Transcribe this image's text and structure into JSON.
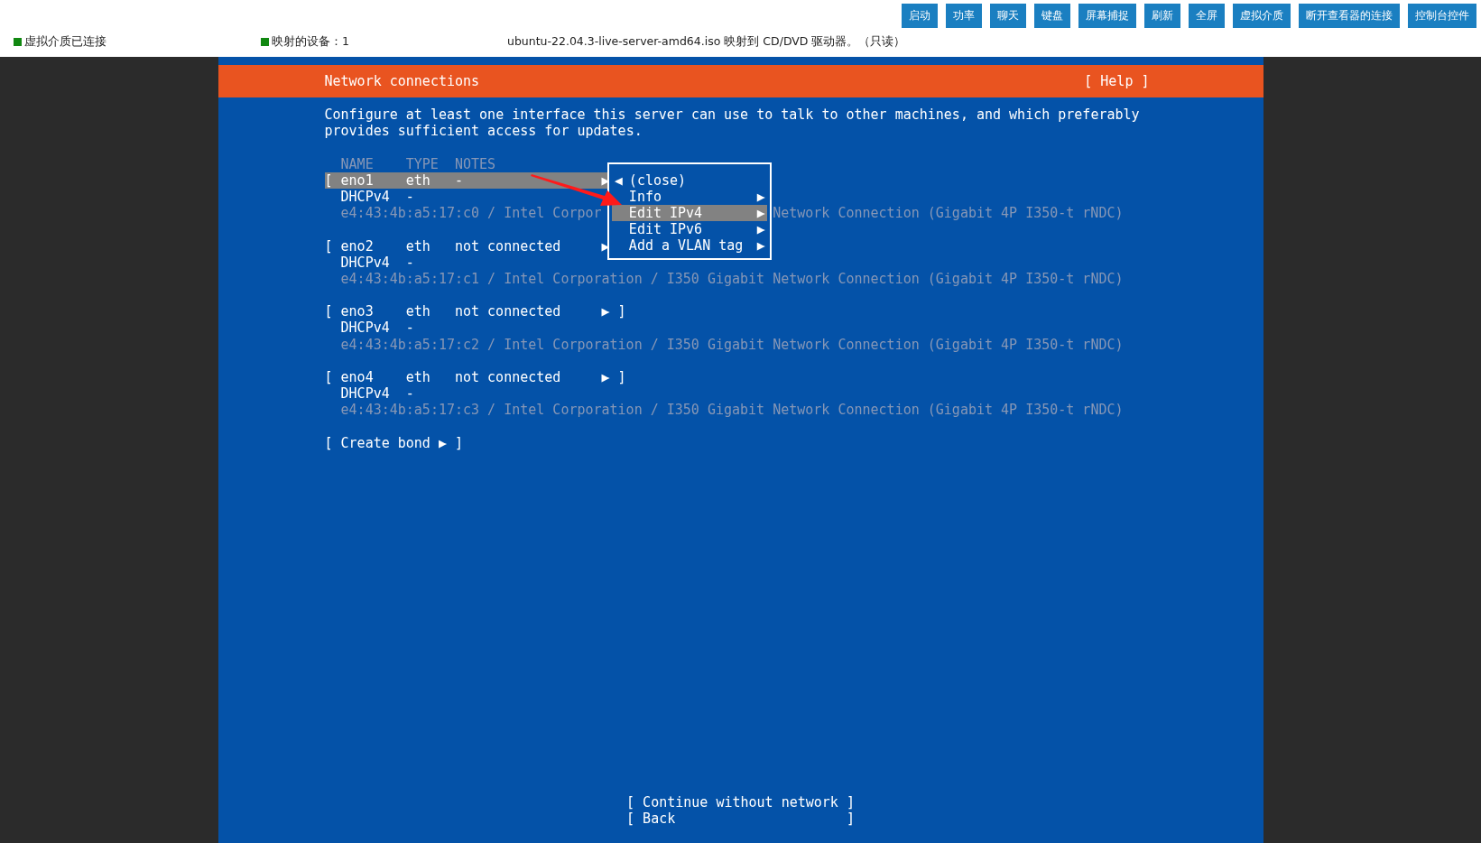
{
  "top_bar": {
    "buttons": [
      "启动",
      "功率",
      "聊天",
      "键盘",
      "屏幕捕捉",
      "刷新",
      "全屏",
      "虚拟介质",
      "断开查看器的连接",
      "控制台控件"
    ],
    "status": [
      {
        "text": "虚拟介质已连接",
        "indicator": true
      },
      {
        "text": "映射的设备：1",
        "indicator": true
      },
      {
        "text": "ubuntu-22.04.3-live-server-amd64.iso 映射到 CD/DVD 驱动器。（只读）",
        "indicator": false
      }
    ]
  },
  "screen": {
    "title": "Network connections",
    "help": "[ Help ]",
    "intro": "Configure at least one interface this server can use to talk to other machines, and which preferably provides sufficient access for updates.",
    "columns": [
      "NAME",
      "TYPE",
      "NOTES"
    ],
    "interfaces": [
      {
        "open": "[",
        "name": "eno1",
        "type": "eth",
        "notes": "-",
        "arrow": "▶",
        "selected": true,
        "dhcp": "DHCPv4  -",
        "detail": [
          "e4:43:4b:a5:17:c0 / Intel Corpor",
          "Network Connection (Gigabit 4P I350-t rNDC)"
        ]
      },
      {
        "open": "[",
        "name": "eno2",
        "type": "eth",
        "notes": "not connected",
        "arrow": "▶",
        "selected": false,
        "dhcp": "DHCPv4  -",
        "detail": [
          "e4:43:4b:a5:17:c1 / Intel Corporation / I350 Gigabit Network Connection (Gigabit 4P I350-t rNDC)"
        ]
      },
      {
        "open": "[",
        "name": "eno3",
        "type": "eth",
        "notes": "not connected",
        "arrow": "▶",
        "close": "]",
        "selected": false,
        "dhcp": "DHCPv4  -",
        "detail": [
          "e4:43:4b:a5:17:c2 / Intel Corporation / I350 Gigabit Network Connection (Gigabit 4P I350-t rNDC)"
        ]
      },
      {
        "open": "[",
        "name": "eno4",
        "type": "eth",
        "notes": "not connected",
        "arrow": "▶",
        "close": "]",
        "selected": false,
        "dhcp": "DHCPv4  -",
        "detail": [
          "e4:43:4b:a5:17:c3 / Intel Corporation / I350 Gigabit Network Connection (Gigabit 4P I350-t rNDC)"
        ]
      }
    ],
    "create_bond": {
      "open": "[",
      "label": "Create bond ▶",
      "close": "]"
    },
    "menu": [
      {
        "label": "(close)",
        "arrow_left": "◀",
        "selected": false
      },
      {
        "label": "Info",
        "arrow_right": "▶",
        "selected": false
      },
      {
        "label": "Edit IPv4",
        "arrow_right": "▶",
        "selected": true
      },
      {
        "label": "Edit IPv6",
        "arrow_right": "▶",
        "selected": false
      },
      {
        "label": "Add a VLAN tag",
        "arrow_right": "▶",
        "selected": false
      }
    ],
    "footer_buttons": [
      {
        "open": "[",
        "label": "Continue without network",
        "close": "]"
      },
      {
        "open": "[",
        "label": "Back",
        "close": "]"
      }
    ]
  }
}
